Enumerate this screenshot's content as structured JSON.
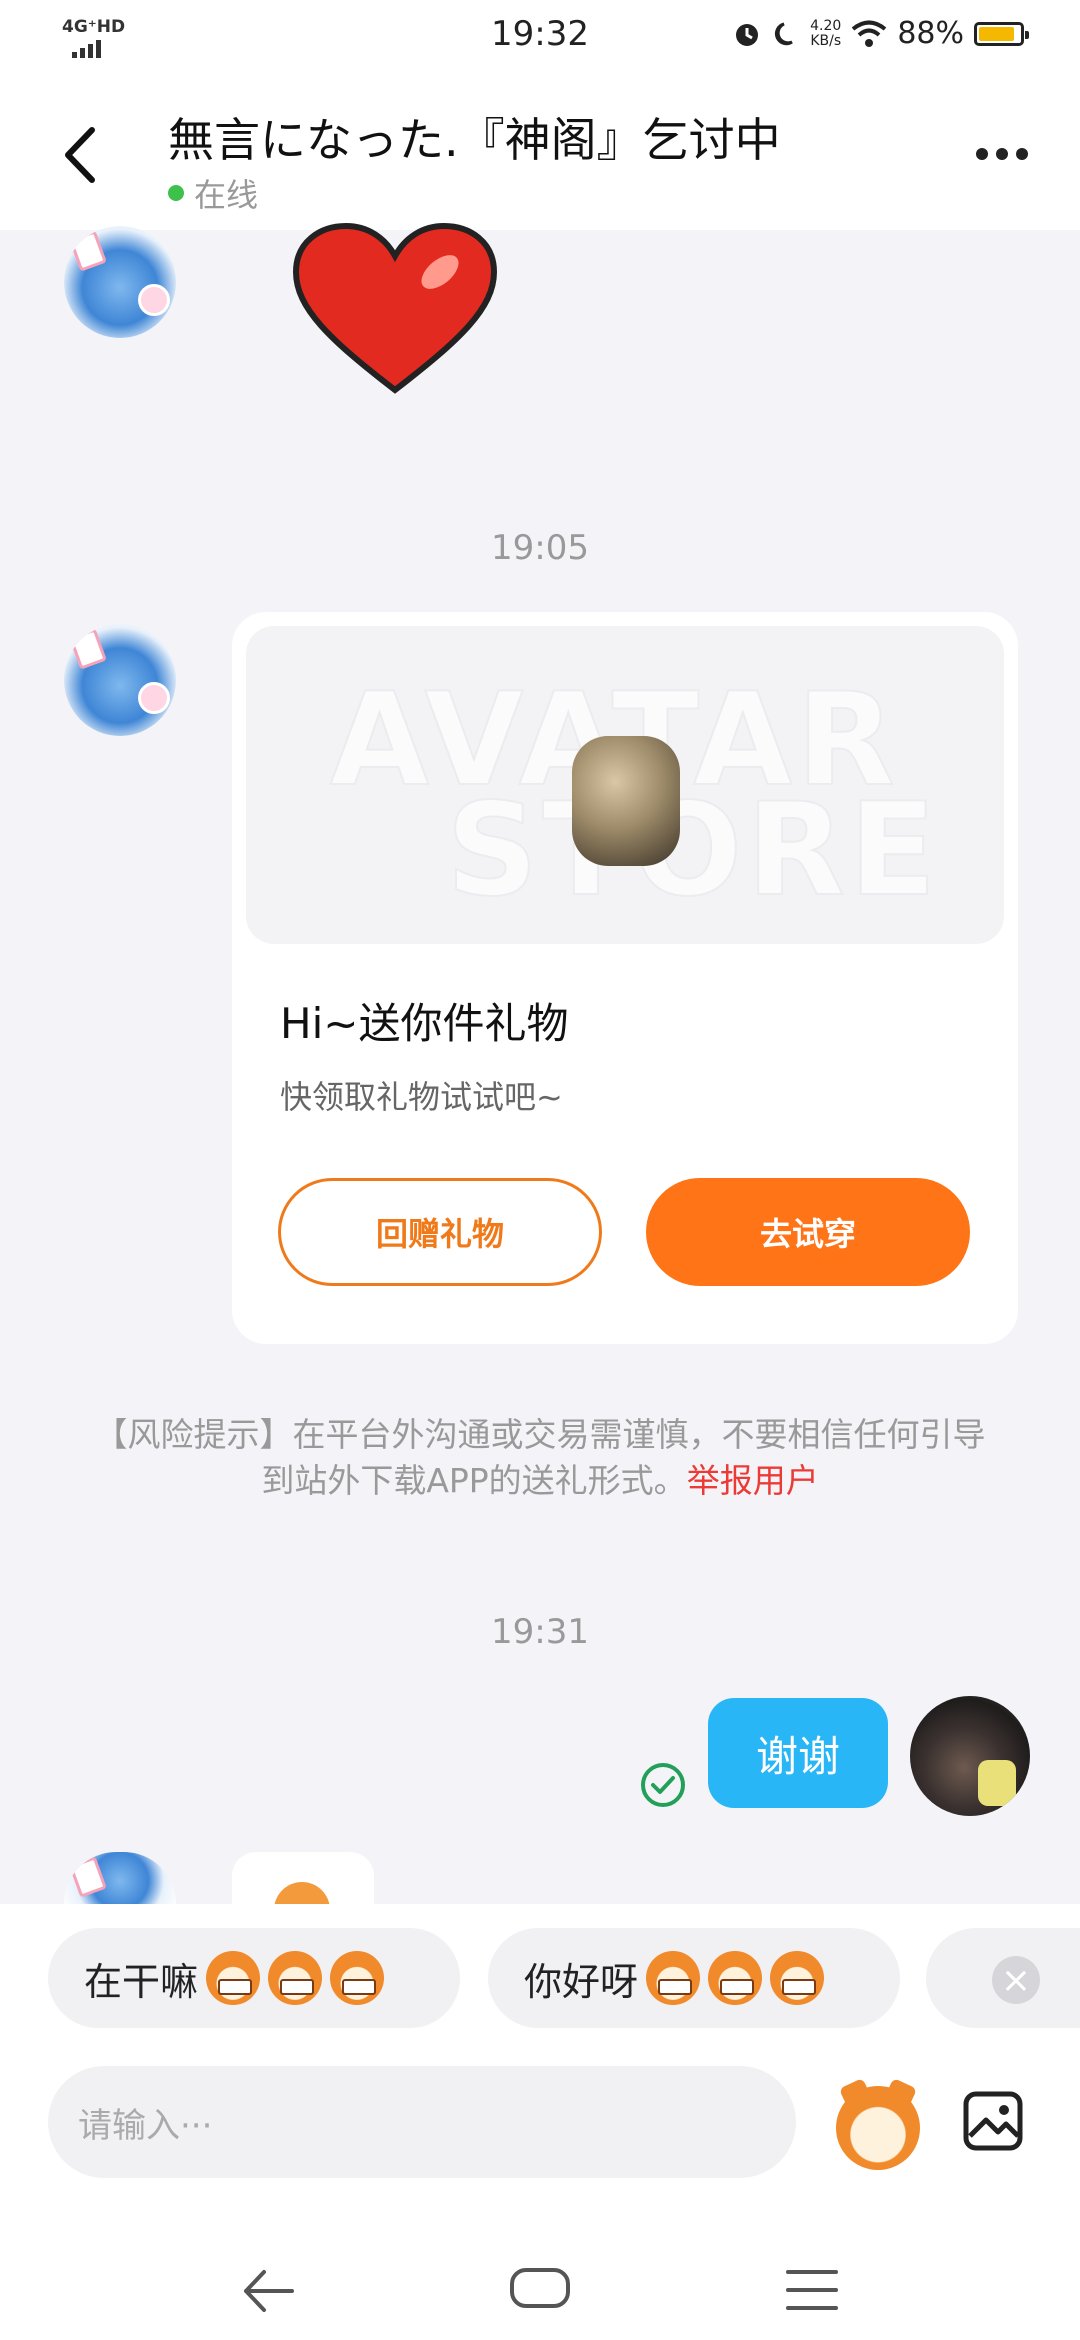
{
  "status_bar": {
    "network": "4G⁺HD",
    "time": "19:32",
    "speed_value": "4.20",
    "speed_unit": "KB/s",
    "battery_percent": "88%",
    "battery_level": 0.88
  },
  "header": {
    "title": "無言になった.『神阁』乞讨中",
    "status": "在线"
  },
  "messages": {
    "timestamp_1": "19:05",
    "timestamp_2": "19:31"
  },
  "gift_card": {
    "watermark_line1": "AVATAR",
    "watermark_line2": "STORE",
    "title": "Hi~送你件礼物",
    "subtitle": "快领取礼物试试吧~",
    "return_button": "回赠礼物",
    "try_button": "去试穿"
  },
  "risk_notice": {
    "text": "【风险提示】在平台外沟通或交易需谨慎，不要相信任何引导到站外下载APP的送礼形式。",
    "report_link": "举报用户"
  },
  "my_message": {
    "text": "谢谢"
  },
  "quick_replies": [
    {
      "label": "在干嘛"
    },
    {
      "label": "你好呀"
    }
  ],
  "input": {
    "placeholder": "请输入···"
  },
  "colors": {
    "accent": "#ff7416",
    "bubble": "#29b6f6",
    "report": "#ec3b36",
    "online": "#3ec14a"
  }
}
